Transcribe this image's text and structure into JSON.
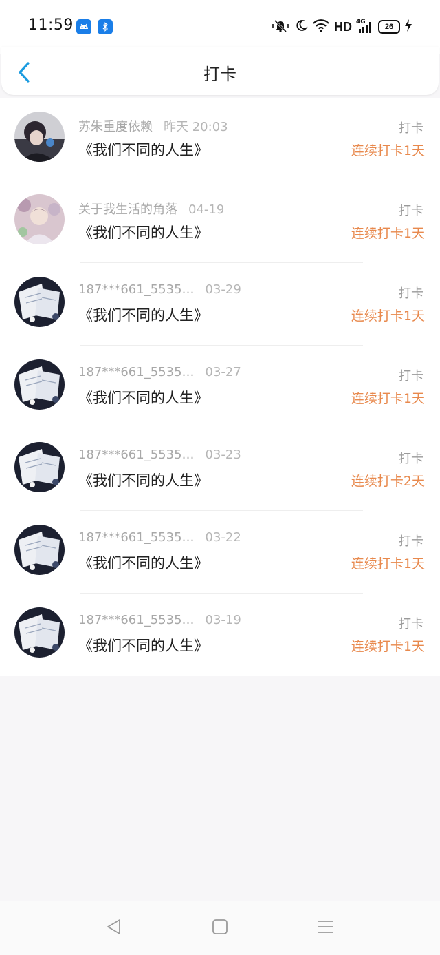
{
  "status_bar": {
    "time": "11:59",
    "network": "HD",
    "signal_label": "4G",
    "battery": "26"
  },
  "header": {
    "title": "打卡"
  },
  "records": [
    {
      "user": "苏朱重度依赖",
      "time": "昨天 20:03",
      "book": "《我们不同的人生》",
      "action": "打卡",
      "streak": "连续打卡1天"
    },
    {
      "user": "关于我生活的角落",
      "time": "04-19",
      "book": "《我们不同的人生》",
      "action": "打卡",
      "streak": "连续打卡1天"
    },
    {
      "user": "187***661_5535…",
      "time": "03-29",
      "book": "《我们不同的人生》",
      "action": "打卡",
      "streak": "连续打卡1天"
    },
    {
      "user": "187***661_5535…",
      "time": "03-27",
      "book": "《我们不同的人生》",
      "action": "打卡",
      "streak": "连续打卡1天"
    },
    {
      "user": "187***661_5535…",
      "time": "03-23",
      "book": "《我们不同的人生》",
      "action": "打卡",
      "streak": "连续打卡2天"
    },
    {
      "user": "187***661_5535…",
      "time": "03-22",
      "book": "《我们不同的人生》",
      "action": "打卡",
      "streak": "连续打卡1天"
    },
    {
      "user": "187***661_5535…",
      "time": "03-19",
      "book": "《我们不同的人生》",
      "action": "打卡",
      "streak": "连续打卡1天"
    }
  ],
  "colors": {
    "accent": "#1a9be0",
    "streak": "#e8894d",
    "meta_text": "#a8a8a8"
  }
}
